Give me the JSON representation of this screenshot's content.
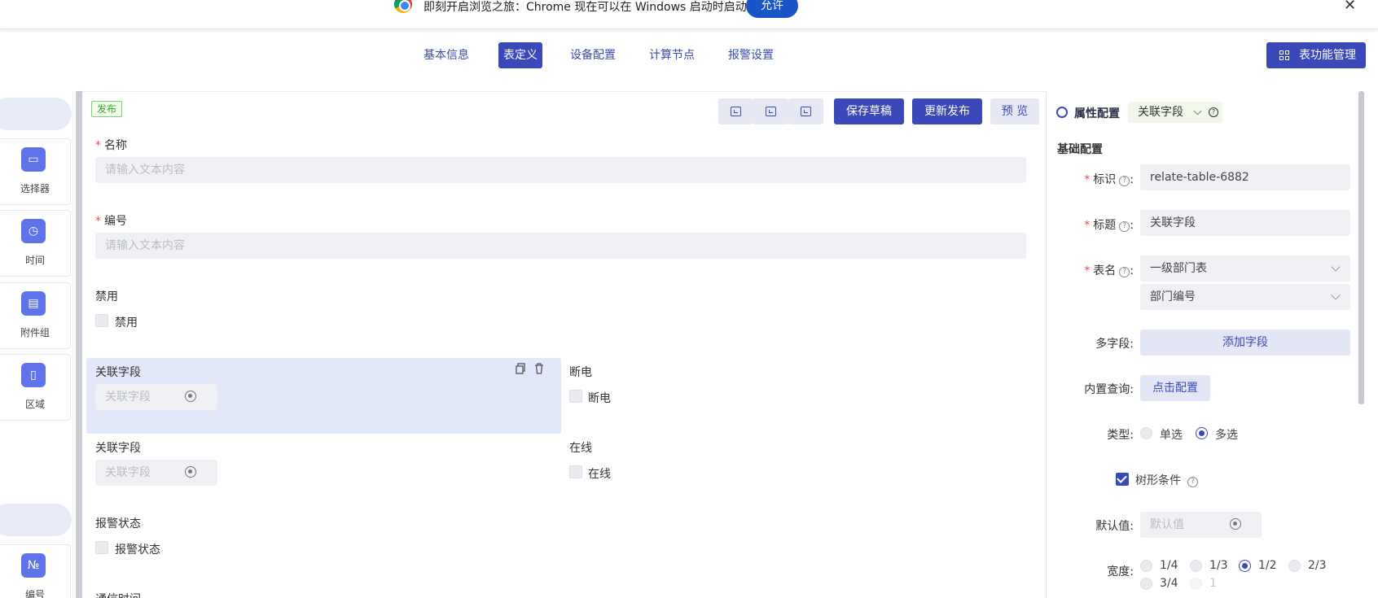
{
  "notification": {
    "message": "即刻开启浏览之旅：Chrome 现在可以在 Windows 启动时启动。",
    "allow_label": "允许",
    "close_label": "✕"
  },
  "tabs": [
    {
      "label": "基本信息",
      "active": false
    },
    {
      "label": "表定义",
      "active": true
    },
    {
      "label": "设备配置",
      "active": false
    },
    {
      "label": "计算节点",
      "active": false
    },
    {
      "label": "报警设置",
      "active": false
    }
  ],
  "function_button_label": "表功能管理",
  "palette": {
    "items": [
      {
        "label": "选择器",
        "icon": "selector-icon",
        "glyph": "▭"
      },
      {
        "label": "时间",
        "icon": "clock-icon",
        "glyph": "◷"
      },
      {
        "label": "附件组",
        "icon": "folder-icon",
        "glyph": "▤"
      },
      {
        "label": "区域",
        "icon": "map-icon",
        "glyph": "▯"
      },
      {
        "label": "编号",
        "icon": "number-icon",
        "glyph": "№"
      }
    ]
  },
  "canvas": {
    "status_badge": "发布",
    "actions": {
      "save_draft": "保存草稿",
      "update_publish": "更新发布",
      "preview": "预 览"
    },
    "fields": {
      "name_label": "名称",
      "name_placeholder": "请输入文本内容",
      "code_label": "编号",
      "code_placeholder": "请输入文本内容",
      "disabled_label": "禁用",
      "disabled_option": "禁用",
      "relate1_label": "关联字段",
      "relate1_placeholder": "关联字段",
      "power_label": "断电",
      "power_option": "断电",
      "relate2_label": "关联字段",
      "relate2_placeholder": "关联字段",
      "online_label": "在线",
      "online_option": "在线",
      "alarm_label": "报警状态",
      "alarm_option": "报警状态",
      "comm_label": "通信时间"
    }
  },
  "props": {
    "title": "属性配置",
    "component_type": "关联字段",
    "section": "基础配置",
    "id_label": "标识",
    "id_value": "relate-table-6882",
    "caption_label": "标题",
    "caption_value": "关联字段",
    "table_label": "表名",
    "table_value": "一级部门表",
    "field_value": "部门编号",
    "multi_label": "多字段:",
    "add_field": "添加字段",
    "query_label": "内置查询:",
    "query_btn": "点击配置",
    "type_label": "类型:",
    "type_options": [
      {
        "label": "单选",
        "checked": false
      },
      {
        "label": "多选",
        "checked": true
      }
    ],
    "tree_label": "树形条件",
    "tree_checked": true,
    "default_label": "默认值:",
    "default_placeholder": "默认值",
    "width_label": "宽度:",
    "width_options": [
      {
        "label": "1/4",
        "checked": false,
        "disabled": false
      },
      {
        "label": "1/3",
        "checked": false,
        "disabled": false
      },
      {
        "label": "1/2",
        "checked": true,
        "disabled": false
      },
      {
        "label": "2/3",
        "checked": false,
        "disabled": false
      },
      {
        "label": "3/4",
        "checked": false,
        "disabled": false
      },
      {
        "label": "1",
        "checked": false,
        "disabled": true
      }
    ]
  }
}
